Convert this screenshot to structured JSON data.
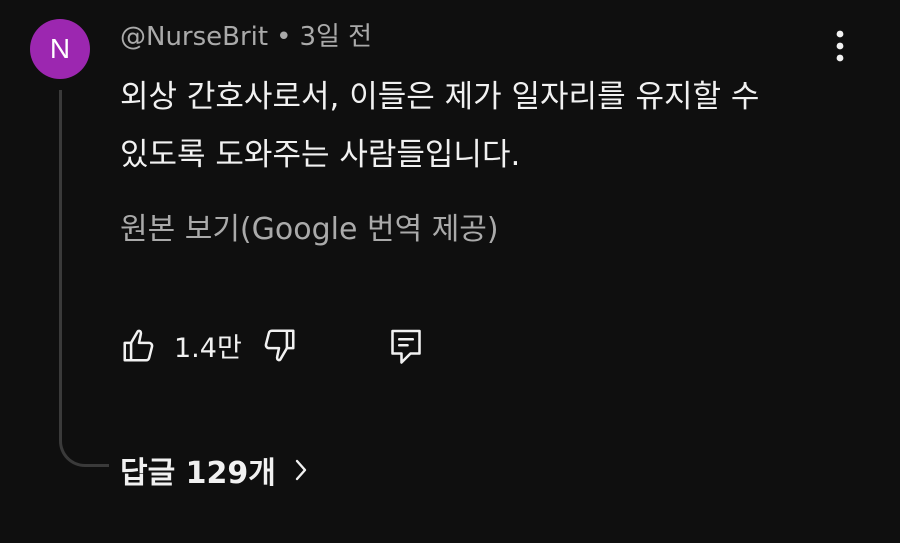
{
  "comment": {
    "avatar_letter": "N",
    "avatar_color": "#9c27b0",
    "author": "@NurseBrit",
    "separator": "•",
    "timestamp": "3일 전",
    "text_line1": "외상 간호사로서, 이들은 제가 일자리를 유지할 수",
    "text_line2": "있도록 도와주는 사람들입니다.",
    "translate_label": "원본 보기(Google 번역 제공)",
    "like_count": "1.4만",
    "replies_label": "답글 129개"
  },
  "icons": {
    "more": "vertical-dots-icon",
    "like": "thumbs-up-icon",
    "dislike": "thumbs-down-icon",
    "reply": "comment-reply-icon",
    "chevron": "chevron-right-icon"
  }
}
